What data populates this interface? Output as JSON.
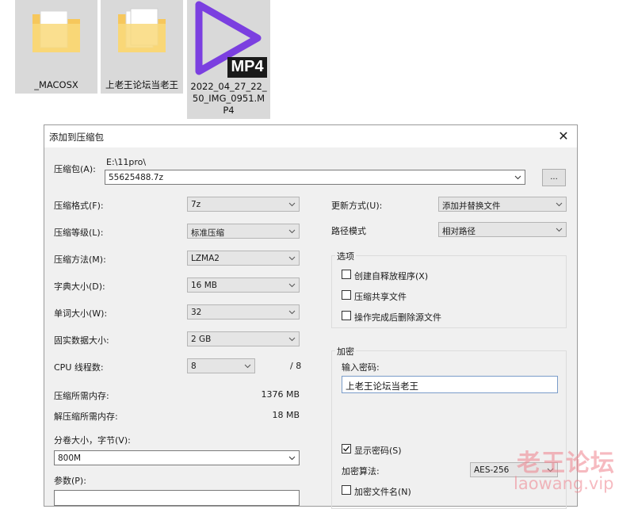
{
  "files": [
    {
      "name": "_MACOSX",
      "icon": "folder-icon"
    },
    {
      "name": "上老王论坛当老王",
      "icon": "folder-icon"
    },
    {
      "name": "2022_04_27_22_50_IMG_0951.MP4",
      "icon": "mp4-video-icon",
      "badge": "MP4"
    }
  ],
  "dialog": {
    "title": "添加到压缩包",
    "archive_label": "压缩包(A):",
    "archive_path": "E:\\11pro\\",
    "archive_name": "55625488.7z",
    "browse_label": "...",
    "left": {
      "format_label": "压缩格式(F):",
      "format_value": "7z",
      "level_label": "压缩等级(L):",
      "level_value": "标准压缩",
      "method_label": "压缩方法(M):",
      "method_value": "LZMA2",
      "dict_label": "字典大小(D):",
      "dict_value": "16 MB",
      "word_label": "单词大小(W):",
      "word_value": "32",
      "solid_label": "固实数据大小:",
      "solid_value": "2 GB",
      "cpu_label": "CPU 线程数:",
      "cpu_value": "8",
      "cpu_max": "/ 8",
      "mem_compress_label": "压缩所需内存:",
      "mem_compress_value": "1376 MB",
      "mem_decompress_label": "解压缩所需内存:",
      "mem_decompress_value": "18 MB",
      "split_label": "分卷大小，字节(V):",
      "split_value": "800M",
      "params_label": "参数(P):"
    },
    "right": {
      "update_label": "更新方式(U):",
      "update_value": "添加并替换文件",
      "path_label": "路径模式",
      "path_value": "相对路径",
      "options_title": "选项",
      "opt_sfx": "创建自释放程序(X)",
      "opt_shared": "压缩共享文件",
      "opt_delete": "操作完成后删除源文件",
      "encrypt_title": "加密",
      "password_label": "输入密码:",
      "password_value": "上老王论坛当老王",
      "show_password": "显示密码(S)",
      "method_label": "加密算法:",
      "method_value": "AES-256",
      "encrypt_names": "加密文件名(N)"
    }
  },
  "watermark": {
    "text": "老王论坛",
    "url": "laowang.vip"
  },
  "colors": {
    "folder": "#f6c75c",
    "mp4_accent": "#7b3fe0",
    "selection": "#d9d9d9",
    "watermark": "#ee828c"
  }
}
